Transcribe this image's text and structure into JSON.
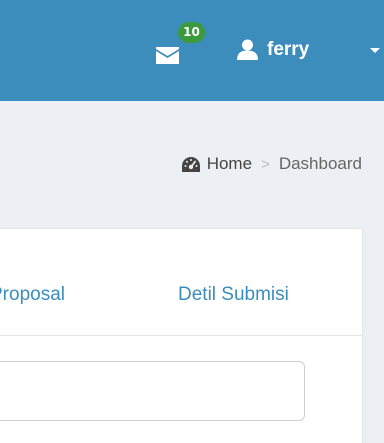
{
  "navbar": {
    "mail": {
      "icon": "envelope-icon",
      "badge_count": "10",
      "badge_color": "#3c9a3c"
    },
    "user": {
      "icon": "user-icon",
      "name": "ferry",
      "caret_icon": "caret-down-icon"
    },
    "background_color": "#3c8dbc"
  },
  "breadcrumb": {
    "icon": "dashboard-icon",
    "home_label": "Home",
    "separator": ">",
    "current_label": "Dashboard"
  },
  "tabs": [
    {
      "label": "Proposal"
    },
    {
      "label": "Detil Submisi"
    }
  ],
  "form": {
    "text_field_value": ""
  },
  "colors": {
    "accent": "#3c8dbc",
    "page_background": "#ecf0f5"
  }
}
